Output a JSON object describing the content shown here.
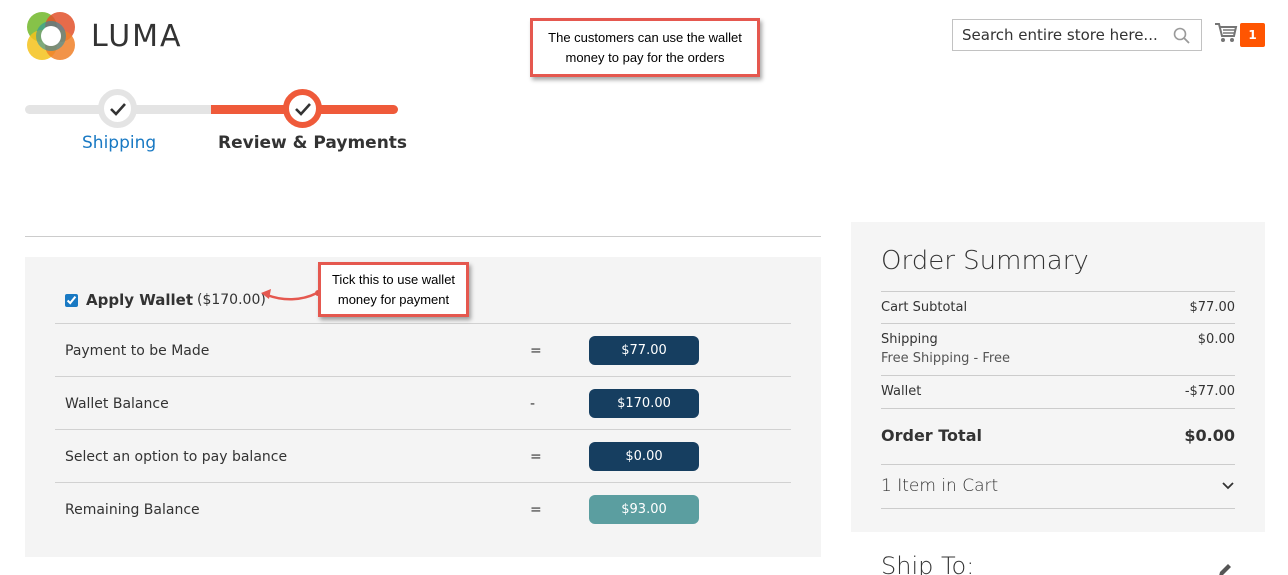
{
  "header": {
    "logo_text": "LUMA",
    "search_placeholder": "Search entire store here...",
    "cart_count": "1"
  },
  "callouts": {
    "top": "The customers can use the wallet money to pay for the orders",
    "tick": "Tick this to use wallet money for payment"
  },
  "progress": {
    "steps": [
      {
        "label": "Shipping",
        "state": "complete"
      },
      {
        "label": "Review & Payments",
        "state": "active"
      }
    ]
  },
  "wallet": {
    "apply_label": "Apply Wallet",
    "apply_amount": "($170.00)",
    "checked": true,
    "rows": [
      {
        "label": "Payment to be Made",
        "op": "=",
        "value": "$77.00"
      },
      {
        "label": "Wallet Balance",
        "op": "-",
        "value": "$170.00"
      },
      {
        "label": "Select an option to pay balance",
        "op": "=",
        "value": "$0.00"
      },
      {
        "label": "Remaining Balance",
        "op": "=",
        "value": "$93.00"
      }
    ]
  },
  "summary": {
    "title": "Order Summary",
    "subtotal_label": "Cart Subtotal",
    "subtotal_value": "$77.00",
    "shipping_label": "Shipping",
    "shipping_method": "Free Shipping - Free",
    "shipping_value": "$0.00",
    "wallet_label": "Wallet",
    "wallet_value": "-$77.00",
    "total_label": "Order Total",
    "total_value": "$0.00",
    "items_label": "1 Item in Cart"
  },
  "ship_to": {
    "title": "Ship To:"
  },
  "colors": {
    "accent": "#ef5a3a",
    "link": "#1979c3",
    "badge_dark": "#163e60",
    "badge_teal": "#5b9ea0",
    "cart_badge": "#ff5501"
  }
}
